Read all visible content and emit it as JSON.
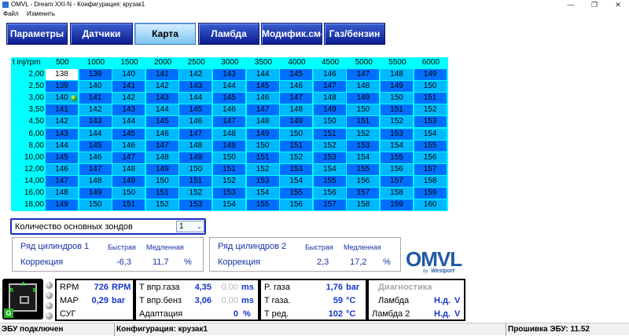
{
  "window": {
    "title": "OMVL - Dream XXI-N - Конфигурация: крузак1",
    "menu": [
      "Файл",
      "Изменить"
    ],
    "controls": [
      "—",
      "❐",
      "✕"
    ]
  },
  "tabs": [
    {
      "label": "Параметры",
      "active": false
    },
    {
      "label": "Датчики",
      "active": false
    },
    {
      "label": "Карта",
      "active": true
    },
    {
      "label": "Ламбда",
      "active": false
    },
    {
      "label": "Модифик.смеси",
      "active": false
    },
    {
      "label": "Газ/бензин",
      "active": false
    }
  ],
  "map": {
    "corner_label": "t inj/rpm",
    "rpm": [
      "500",
      "1000",
      "1500",
      "2000",
      "2500",
      "3000",
      "3500",
      "4000",
      "4500",
      "5000",
      "5500",
      "6000"
    ],
    "tinj": [
      "2,00",
      "2,50",
      "3,00",
      "3,50",
      "4,50",
      "6,00",
      "8,00",
      "10,00",
      "12,00",
      "14,00",
      "16,00",
      "18,00"
    ],
    "values": [
      [
        138,
        139,
        140,
        141,
        142,
        143,
        144,
        145,
        146,
        147,
        148,
        149
      ],
      [
        139,
        140,
        141,
        142,
        143,
        144,
        145,
        146,
        147,
        148,
        149,
        150
      ],
      [
        140,
        141,
        142,
        143,
        144,
        145,
        146,
        147,
        148,
        149,
        150,
        151
      ],
      [
        141,
        142,
        143,
        144,
        145,
        146,
        147,
        148,
        149,
        150,
        151,
        152
      ],
      [
        142,
        143,
        144,
        145,
        146,
        147,
        148,
        149,
        150,
        151,
        152,
        153
      ],
      [
        143,
        144,
        145,
        146,
        147,
        148,
        149,
        150,
        151,
        152,
        153,
        154
      ],
      [
        144,
        145,
        146,
        147,
        148,
        149,
        150,
        151,
        152,
        153,
        154,
        155
      ],
      [
        145,
        146,
        147,
        148,
        149,
        150,
        151,
        152,
        153,
        154,
        155,
        156
      ],
      [
        146,
        147,
        148,
        149,
        150,
        151,
        152,
        153,
        154,
        155,
        156,
        157
      ],
      [
        147,
        148,
        149,
        150,
        151,
        152,
        153,
        154,
        155,
        156,
        157,
        158
      ],
      [
        148,
        149,
        150,
        151,
        152,
        153,
        154,
        155,
        156,
        157,
        158,
        159
      ],
      [
        149,
        150,
        151,
        152,
        153,
        154,
        155,
        156,
        157,
        158,
        159,
        160
      ]
    ],
    "selected_cell": [
      0,
      0
    ],
    "marker_cell": [
      2,
      0
    ],
    "colors": {
      "light": "#00b8ff",
      "dark": "#006fff",
      "header": "#00ffff",
      "selected": "#ffffff"
    }
  },
  "probe": {
    "label": "Количество основных зондов",
    "value": "1"
  },
  "banks": [
    {
      "title": "Ряд цилиндров 1",
      "fast_label": "Быстрая",
      "slow_label": "Медленная",
      "correction_label": "Коррекция",
      "fast": "-6,3",
      "slow": "11,7",
      "unit": "%"
    },
    {
      "title": "Ряд цилиндров 2",
      "fast_label": "Быстрая",
      "slow_label": "Медленная",
      "correction_label": "Коррекция",
      "fast": "2,3",
      "slow": "17,2",
      "unit": "%"
    }
  ],
  "logo": {
    "brand": "OMVL",
    "by": "by",
    "partner": "Westport"
  },
  "ecu_icon": {
    "letters": [
      "R",
      "E",
      "A",
      "G"
    ]
  },
  "dash1": [
    {
      "label": "RPM",
      "value": "726",
      "unit": "RPM"
    },
    {
      "label": "MAP",
      "value": "0,29",
      "unit": "bar"
    },
    {
      "label": "СУГ",
      "value": "",
      "unit": ""
    }
  ],
  "dash2": [
    {
      "label": "T впр.газа",
      "value": "4,35",
      "value2": "0,00",
      "unit": "ms"
    },
    {
      "label": "T впр.бенз",
      "value": "3,06",
      "value2": "0,00",
      "unit": "ms"
    },
    {
      "label": "Адаптация",
      "value": "0",
      "value2": "",
      "unit": "%"
    }
  ],
  "dash3": [
    {
      "label": "P. газа",
      "value": "1,76",
      "unit": "bar"
    },
    {
      "label": "T газа.",
      "value": "59",
      "unit": "°C"
    },
    {
      "label": "T ред.",
      "value": "102",
      "unit": "°C"
    }
  ],
  "dash4": {
    "title": "Диагностика",
    "rows": [
      {
        "label": "Ламбда",
        "value": "Н.д.",
        "unit": "V"
      },
      {
        "label": "Ламбда 2",
        "value": "Н.д.",
        "unit": "V"
      }
    ]
  },
  "status": {
    "ecu": "ЭБУ подключен",
    "config": "Конфигурация: крузак1",
    "firmware": "Прошивка ЭБУ: 11.52"
  }
}
